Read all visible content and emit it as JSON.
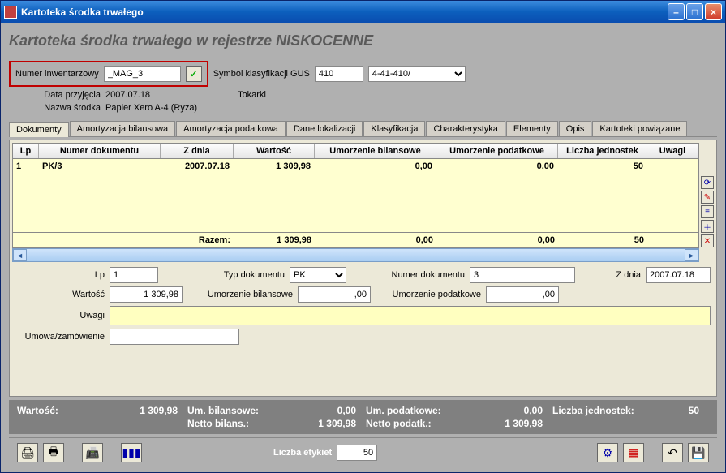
{
  "window": {
    "title": "Kartoteka środka trwałego"
  },
  "page": {
    "title_prefix": "Kartoteka środka trwałego w rejestrze ",
    "register": "NISKOCENNE"
  },
  "header": {
    "inv_label": "Numer inwentarzowy",
    "inv_value": "_MAG_3",
    "gus_label": "Symbol klasyfikacji GUS",
    "gus_code": "410",
    "gus_combo": "4-41-410/",
    "date_label": "Data przyjęcia",
    "date_value": "2007.07.18",
    "tokarki": "Tokarki",
    "name_label": "Nazwa środka",
    "name_value": "Papier Xero A-4 (Ryza)"
  },
  "tabs": [
    "Dokumenty",
    "Amortyzacja bilansowa",
    "Amortyzacja podatkowa",
    "Dane lokalizacji",
    "Klasyfikacja",
    "Charakterystyka",
    "Elementy",
    "Opis",
    "Kartoteki powiązane"
  ],
  "grid": {
    "cols": [
      "Lp",
      "Numer dokumentu",
      "Z dnia",
      "Wartość",
      "Umorzenie bilansowe",
      "Umorzenie podatkowe",
      "Liczba jednostek",
      "Uwagi"
    ],
    "row": {
      "lp": "1",
      "nd": "PK/3",
      "zd": "2007.07.18",
      "wa": "1 309,98",
      "ub": "0,00",
      "up": "0,00",
      "lj": "50",
      "uw": ""
    },
    "sum_label": "Razem:",
    "sum": {
      "wa": "1 309,98",
      "ub": "0,00",
      "up": "0,00",
      "lj": "50"
    }
  },
  "form": {
    "lp_label": "Lp",
    "lp": "1",
    "typ_label": "Typ dokumentu",
    "typ": "PK",
    "num_label": "Numer dokumentu",
    "num": "3",
    "zd_label": "Z dnia",
    "zd": "2007.07.18",
    "wa_label": "Wartość",
    "wa": "1 309,98",
    "ub_label": "Umorzenie bilansowe",
    "ub": ",00",
    "up_label": "Umorzenie podatkowe",
    "up": ",00",
    "uwagi_label": "Uwagi",
    "umowa_label": "Umowa/zamówienie"
  },
  "summary": {
    "wa_l": "Wartość:",
    "wa": "1 309,98",
    "ub_l": "Um. bilansowe:",
    "ub": "0,00",
    "up_l": "Um. podatkowe:",
    "up": "0,00",
    "lj_l": "Liczba jednostek:",
    "lj": "50",
    "nb_l": "Netto bilans.:",
    "nb": "1 309,98",
    "np_l": "Netto podatk.:",
    "np": "1 309,98"
  },
  "toolbar": {
    "etyk_label": "Liczba etykiet",
    "etyk_val": "50"
  }
}
